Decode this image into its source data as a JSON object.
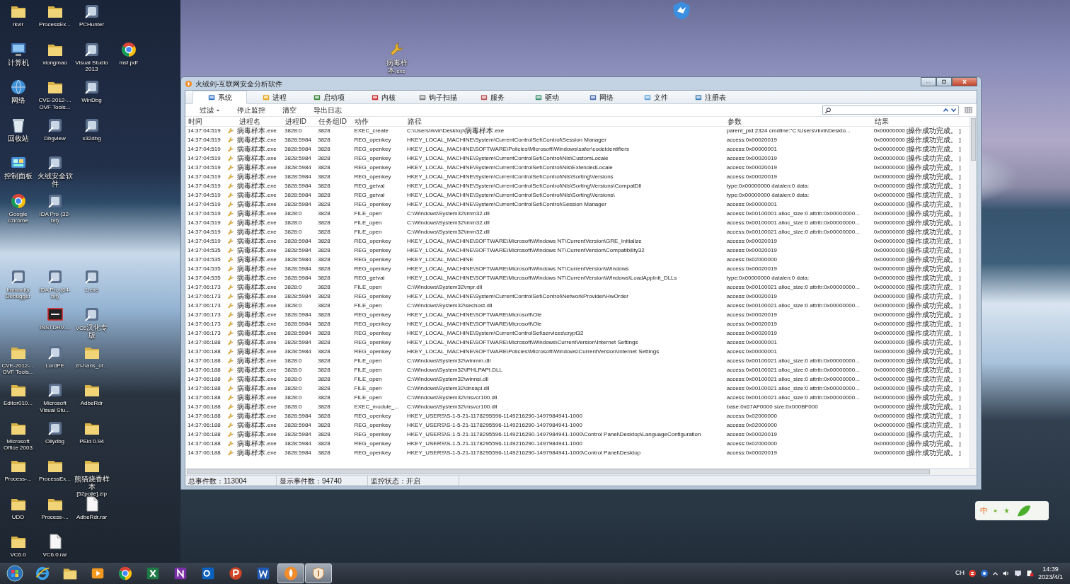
{
  "desktop": {
    "columns": [
      [
        {
          "label": "rkvir",
          "kind": "folder"
        },
        {
          "label": "计算机",
          "kind": "computer"
        },
        {
          "label": "网络",
          "kind": "network"
        },
        {
          "label": "回收站",
          "kind": "recycle"
        },
        {
          "label": "控制面板",
          "kind": "control"
        },
        {
          "label": "Google Chrome",
          "kind": "browser"
        },
        null,
        {
          "label": "Immunity Debugger",
          "kind": "app"
        },
        null,
        {
          "label": "CVE-2012-... OVF Tools...",
          "kind": "folder"
        },
        {
          "label": "Editor010...",
          "kind": "folder"
        },
        {
          "label": "Microsoft Office 2003",
          "kind": "folder"
        },
        {
          "label": "Process-...",
          "kind": "folder"
        },
        {
          "label": "UDD",
          "kind": "folder"
        },
        {
          "label": "VC6.0",
          "kind": "folder"
        }
      ],
      [
        {
          "label": "ProcessEx...",
          "kind": "folder"
        },
        {
          "label": "xiongmao",
          "kind": "folder"
        },
        {
          "label": "CVE-2012-... OVF Tools...",
          "kind": "folder"
        },
        {
          "label": "Dbgview",
          "kind": "app"
        },
        {
          "label": "火绒安全软件",
          "kind": "app"
        },
        {
          "label": "IDA Pro (32-bit)",
          "kind": "app"
        },
        null,
        {
          "label": "IDA Pro (64-bit)",
          "kind": "app"
        },
        {
          "label": "INSTDRV....",
          "kind": "sys"
        },
        {
          "label": "LordPE",
          "kind": "app"
        },
        {
          "label": "Microsoft Visual Stu...",
          "kind": "app"
        },
        {
          "label": "Ollydbg",
          "kind": "app"
        },
        {
          "label": "ProcessEx...",
          "kind": "folder"
        },
        {
          "label": "Process-...",
          "kind": "folder"
        },
        {
          "label": "VC6.0.rar",
          "kind": "file"
        }
      ],
      [
        {
          "label": "PCHunter",
          "kind": "app"
        },
        {
          "label": "Visual Studio 2013",
          "kind": "app"
        },
        {
          "label": "WinDbg",
          "kind": "app"
        },
        {
          "label": "x32dbg",
          "kind": "app"
        },
        null,
        null,
        null,
        {
          "label": "1.exe",
          "kind": "app"
        },
        {
          "label": "VC6汉化专版",
          "kind": "app"
        },
        {
          "label": "zh-hans_of...",
          "kind": "folder"
        },
        {
          "label": "AdbeRdr",
          "kind": "folder"
        },
        {
          "label": "PEid 0.94",
          "kind": "folder"
        },
        {
          "label": "熊猫烧香样本[52pojie].zip",
          "kind": "folder"
        },
        {
          "label": "AdbeRdr.rar",
          "kind": "file"
        }
      ],
      [
        null,
        {
          "label": "msf.pdf",
          "kind": "browser"
        }
      ]
    ],
    "loose_icon": {
      "label": "病毒样本.exe",
      "kind": "wrench"
    }
  },
  "window": {
    "title": "火绒剑-互联网安全分析软件",
    "tabs": [
      {
        "label": "系统",
        "selected": true
      },
      {
        "label": "进程",
        "selected": false
      },
      {
        "label": "启动项",
        "selected": false
      },
      {
        "label": "内核",
        "selected": false
      },
      {
        "label": "钩子扫描",
        "selected": false
      },
      {
        "label": "服务",
        "selected": false
      },
      {
        "label": "驱动",
        "selected": false
      },
      {
        "label": "网络",
        "selected": false
      },
      {
        "label": "文件",
        "selected": false
      },
      {
        "label": "注册表",
        "selected": false
      }
    ],
    "toolbar": [
      {
        "label": "过滤",
        "kind": "dropdown"
      },
      {
        "label": "停止监控",
        "kind": "button"
      },
      {
        "label": "清空",
        "kind": "button"
      },
      {
        "label": "导出日志",
        "kind": "button"
      }
    ],
    "table": {
      "columns": [
        "时间",
        "进程名",
        "进程ID",
        "任务组ID",
        "动作",
        "路径",
        "参数",
        "结果"
      ],
      "rows": [
        [
          "14:37:04:519",
          "病毒样本.exe",
          "3828:0",
          "3828",
          "EXEC_create",
          "C:\\Users\\rkvir\\Desktop\\病毒样本.exe",
          "parent_pid:2324 cmdline:\"C:\\Users\\rkvir\\Deskto...",
          "0x00000000 [操作成功完成。 ]"
        ],
        [
          "14:37:04:519",
          "病毒样本.exe",
          "3828:5984",
          "3828",
          "REG_openkey",
          "HKEY_LOCAL_MACHINE\\System\\CurrentControlSet\\Control\\Session Manager",
          "access:0x00020019",
          "0x00000000 [操作成功完成。 ]"
        ],
        [
          "14:37:04:519",
          "病毒样本.exe",
          "3828:5984",
          "3828",
          "REG_openkey",
          "HKEY_LOCAL_MACHINE\\SOFTWARE\\Policies\\Microsoft\\Windows\\safer\\codeidentifiers",
          "access:0x00000001",
          "0x00000000 [操作成功完成。 ]"
        ],
        [
          "14:37:04:519",
          "病毒样本.exe",
          "3828:5984",
          "3828",
          "REG_openkey",
          "HKEY_LOCAL_MACHINE\\System\\CurrentControlSet\\Control\\Nls\\CustomLocale",
          "access:0x00020019",
          "0x00000000 [操作成功完成。 ]"
        ],
        [
          "14:37:04:519",
          "病毒样本.exe",
          "3828:5984",
          "3828",
          "REG_openkey",
          "HKEY_LOCAL_MACHINE\\System\\CurrentControlSet\\Control\\Nls\\ExtendedLocale",
          "access:0x00020019",
          "0x00000000 [操作成功完成。 ]"
        ],
        [
          "14:37:04:519",
          "病毒样本.exe",
          "3828:5984",
          "3828",
          "REG_openkey",
          "HKEY_LOCAL_MACHINE\\System\\CurrentControlSet\\Control\\Nls\\Sorting\\Versions",
          "access:0x00020019",
          "0x00000000 [操作成功完成。 ]"
        ],
        [
          "14:37:04:519",
          "病毒样本.exe",
          "3828:5984",
          "3828",
          "REG_getval",
          "HKEY_LOCAL_MACHINE\\System\\CurrentControlSet\\Control\\Nls\\Sorting\\Versions\\CompatDll",
          "type:0x00000000 datalen:0 data:",
          "0x00000000 [操作成功完成。 ]"
        ],
        [
          "14:37:04:519",
          "病毒样本.exe",
          "3828:5984",
          "3828",
          "REG_getval",
          "HKEY_LOCAL_MACHINE\\System\\CurrentControlSet\\Control\\Nls\\Sorting\\Versions\\",
          "type:0x00000000 datalen:0 data:",
          "0x00000000 [操作成功完成。 ]"
        ],
        [
          "14:37:04:519",
          "病毒样本.exe",
          "3828:5984",
          "3828",
          "REG_openkey",
          "HKEY_LOCAL_MACHINE\\System\\CurrentControlSet\\Control\\Session Manager",
          "access:0x00000001",
          "0x00000000 [操作成功完成。 ]"
        ],
        [
          "14:37:04:519",
          "病毒样本.exe",
          "3828:0",
          "3828",
          "FILE_open",
          "C:\\Windows\\System32\\imm32.dll",
          "access:0x00100001 alloc_size:0 attrib:0x00000000...",
          "0x00000000 [操作成功完成。 ]"
        ],
        [
          "14:37:04:519",
          "病毒样本.exe",
          "3828:0",
          "3828",
          "FILE_open",
          "C:\\Windows\\System32\\imm32.dll",
          "access:0x00100001 alloc_size:0 attrib:0x00000000...",
          "0x00000000 [操作成功完成。 ]"
        ],
        [
          "14:37:04:519",
          "病毒样本.exe",
          "3828:0",
          "3828",
          "FILE_open",
          "C:\\Windows\\System32\\imm32.dll",
          "access:0x00100021 alloc_size:0 attrib:0x00000000...",
          "0x00000000 [操作成功完成。 ]"
        ],
        [
          "14:37:04:519",
          "病毒样本.exe",
          "3828:5984",
          "3828",
          "REG_openkey",
          "HKEY_LOCAL_MACHINE\\SOFTWARE\\Microsoft\\Windows NT\\CurrentVersion\\GRE_Initialize",
          "access:0x00020019",
          "0x00000000 [操作成功完成。 ]"
        ],
        [
          "14:37:04:535",
          "病毒样本.exe",
          "3828:5984",
          "3828",
          "REG_openkey",
          "HKEY_LOCAL_MACHINE\\SOFTWARE\\Microsoft\\Windows NT\\CurrentVersion\\Compatibility32",
          "access:0x00020019",
          "0x00000000 [操作成功完成。 ]"
        ],
        [
          "14:37:04:535",
          "病毒样本.exe",
          "3828:5984",
          "3828",
          "REG_openkey",
          "HKEY_LOCAL_MACHINE",
          "access:0x02000000",
          "0x00000000 [操作成功完成。 ]"
        ],
        [
          "14:37:04:535",
          "病毒样本.exe",
          "3828:5984",
          "3828",
          "REG_openkey",
          "HKEY_LOCAL_MACHINE\\SOFTWARE\\Microsoft\\Windows NT\\CurrentVersion\\Windows",
          "access:0x00020019",
          "0x00000000 [操作成功完成。 ]"
        ],
        [
          "14:37:04:535",
          "病毒样本.exe",
          "3828:5984",
          "3828",
          "REG_getval",
          "HKEY_LOCAL_MACHINE\\SOFTWARE\\Microsoft\\Windows NT\\CurrentVersion\\Windows\\LoadAppInit_DLLs",
          "type:0x00000000 datalen:0 data:",
          "0x00000000 [操作成功完成。 ]"
        ],
        [
          "14:37:06:173",
          "病毒样本.exe",
          "3828:0",
          "3828",
          "FILE_open",
          "C:\\Windows\\System32\\mpr.dll",
          "access:0x00100021 alloc_size:0 attrib:0x00000000...",
          "0x00000000 [操作成功完成。 ]"
        ],
        [
          "14:37:06:173",
          "病毒样本.exe",
          "3828:5984",
          "3828",
          "REG_openkey",
          "HKEY_LOCAL_MACHINE\\System\\CurrentControlSet\\Control\\NetworkProvider\\HwOrder",
          "access:0x00020019",
          "0x00000000 [操作成功完成。 ]"
        ],
        [
          "14:37:06:173",
          "病毒样本.exe",
          "3828:0",
          "3828",
          "FILE_open",
          "C:\\Windows\\System32\\sechost.dll",
          "access:0x00100021 alloc_size:0 attrib:0x00000000...",
          "0x00000000 [操作成功完成。 ]"
        ],
        [
          "14:37:06:173",
          "病毒样本.exe",
          "3828:5984",
          "3828",
          "REG_openkey",
          "HKEY_LOCAL_MACHINE\\SOFTWARE\\Microsoft\\Ole",
          "access:0x00020019",
          "0x00000000 [操作成功完成。 ]"
        ],
        [
          "14:37:06:173",
          "病毒样本.exe",
          "3828:5984",
          "3828",
          "REG_openkey",
          "HKEY_LOCAL_MACHINE\\SOFTWARE\\Microsoft\\Ole",
          "access:0x00020019",
          "0x00000000 [操作成功完成。 ]"
        ],
        [
          "14:37:06:173",
          "病毒样本.exe",
          "3828:5984",
          "3828",
          "REG_openkey",
          "HKEY_LOCAL_MACHINE\\System\\CurrentControlSet\\services\\crypt32",
          "access:0x00020019",
          "0x00000000 [操作成功完成。 ]"
        ],
        [
          "14:37:06:188",
          "病毒样本.exe",
          "3828:5984",
          "3828",
          "REG_openkey",
          "HKEY_LOCAL_MACHINE\\SOFTWARE\\Microsoft\\Windows\\CurrentVersion\\Internet Settings",
          "access:0x00000001",
          "0x00000000 [操作成功完成。 ]"
        ],
        [
          "14:37:06:188",
          "病毒样本.exe",
          "3828:5984",
          "3828",
          "REG_openkey",
          "HKEY_LOCAL_MACHINE\\SOFTWARE\\Policies\\Microsoft\\Windows\\CurrentVersion\\Internet Settings",
          "access:0x00000001",
          "0x00000000 [操作成功完成。 ]"
        ],
        [
          "14:37:06:188",
          "病毒样本.exe",
          "3828:0",
          "3828",
          "FILE_open",
          "C:\\Windows\\System32\\winmm.dll",
          "access:0x00100021 alloc_size:0 attrib:0x00000000...",
          "0x00000000 [操作成功完成。 ]"
        ],
        [
          "14:37:06:188",
          "病毒样本.exe",
          "3828:0",
          "3828",
          "FILE_open",
          "C:\\Windows\\System32\\IPHLPAPI.DLL",
          "access:0x00100021 alloc_size:0 attrib:0x00000000...",
          "0x00000000 [操作成功完成。 ]"
        ],
        [
          "14:37:06:188",
          "病毒样本.exe",
          "3828:0",
          "3828",
          "FILE_open",
          "C:\\Windows\\System32\\winnsi.dll",
          "access:0x00100021 alloc_size:0 attrib:0x00000000...",
          "0x00000000 [操作成功完成。 ]"
        ],
        [
          "14:37:06:188",
          "病毒样本.exe",
          "3828:0",
          "3828",
          "FILE_open",
          "C:\\Windows\\System32\\dnsapi.dll",
          "access:0x00100021 alloc_size:0 attrib:0x00000000...",
          "0x00000000 [操作成功完成。 ]"
        ],
        [
          "14:37:06:188",
          "病毒样本.exe",
          "3828:0",
          "3828",
          "FILE_open",
          "C:\\Windows\\System32\\msvcr100.dll",
          "access:0x00100021 alloc_size:0 attrib:0x00000000...",
          "0x00000000 [操作成功完成。 ]"
        ],
        [
          "14:37:06:188",
          "病毒样本.exe",
          "3828:0",
          "3828",
          "EXEC_module_...",
          "C:\\Windows\\System32\\msvcr100.dll",
          "base:0x67AF0000 size:0x000BF000",
          "0x00000000 [操作成功完成。 ]"
        ],
        [
          "14:37:06:188",
          "病毒样本.exe",
          "3828:5984",
          "3828",
          "REG_openkey",
          "HKEY_USERS\\S-1-5-21-1178295596-1149216290-1497984941-1000",
          "access:0x02000000",
          "0x00000000 [操作成功完成。 ]"
        ],
        [
          "14:37:06:188",
          "病毒样本.exe",
          "3828:5984",
          "3828",
          "REG_openkey",
          "HKEY_USERS\\S-1-5-21-1178295596-1149216290-1497984941-1000",
          "access:0x02000000",
          "0x00000000 [操作成功完成。 ]"
        ],
        [
          "14:37:06:188",
          "病毒样本.exe",
          "3828:5984",
          "3828",
          "REG_openkey",
          "HKEY_USERS\\S-1-5-21-1178295596-1149216290-1497984941-1000\\Control Panel\\Desktop\\LanguageConfiguration",
          "access:0x00020019",
          "0x00000000 [操作成功完成。 ]"
        ],
        [
          "14:37:06:188",
          "病毒样本.exe",
          "3828:5984",
          "3828",
          "REG_openkey",
          "HKEY_USERS\\S-1-5-21-1178295596-1149216290-1497984941-1000",
          "access:0x02000000",
          "0x00000000 [操作成功完成。 ]"
        ],
        [
          "14:37:06:188",
          "病毒样本.exe",
          "3828:5984",
          "3828",
          "REG_openkey",
          "HKEY_USERS\\S-1-5-21-1178295596-1149216290-1497984941-1000\\Control Panel\\Desktop",
          "access:0x00020019",
          "0x00000000 [操作成功完成。 ]"
        ]
      ]
    },
    "status_bar": [
      "总事件数：113004",
      "显示事件数：94740",
      "监控状态：开启"
    ]
  },
  "taskbar": {
    "apps": [
      {
        "kind": "ie",
        "active": false
      },
      {
        "kind": "explorer",
        "active": false
      },
      {
        "kind": "media",
        "active": false
      },
      {
        "kind": "chrome",
        "active": false
      },
      {
        "kind": "excel",
        "active": false
      },
      {
        "kind": "onenote",
        "active": false
      },
      {
        "kind": "outlook",
        "active": false
      },
      {
        "kind": "powerpoint",
        "active": false
      },
      {
        "kind": "word",
        "active": false
      },
      {
        "kind": "huorong",
        "active": true
      },
      {
        "kind": "sword",
        "active": true
      }
    ],
    "tray": {
      "language": "CH",
      "time": "14:39",
      "date": "2023/4/1"
    }
  },
  "ime": {
    "label": "中"
  }
}
